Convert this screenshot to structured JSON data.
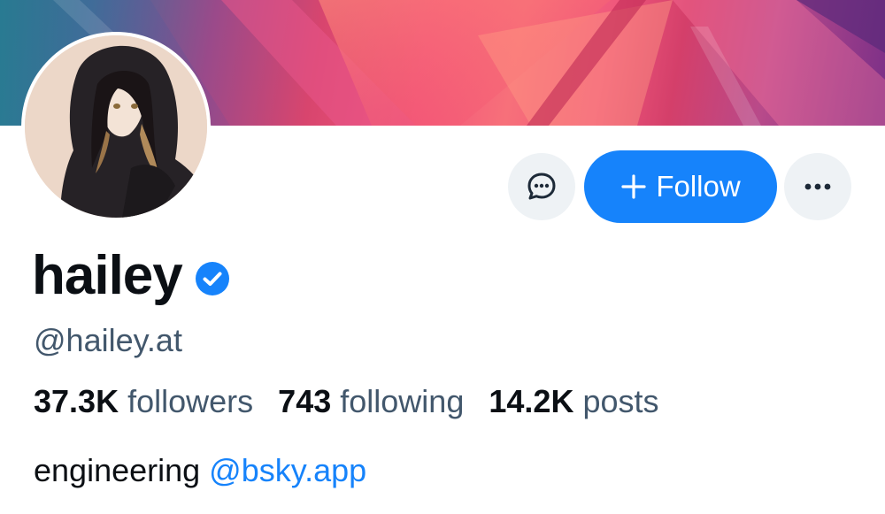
{
  "profile": {
    "display_name": "hailey",
    "handle": "@hailey.at",
    "verified": true
  },
  "actions": {
    "follow_label": "Follow",
    "message_icon": "chat-bubble-icon",
    "more_icon": "ellipsis-icon"
  },
  "stats": {
    "followers_count": "37.3K",
    "followers_label": "followers",
    "following_count": "743",
    "following_label": "following",
    "posts_count": "14.2K",
    "posts_label": "posts"
  },
  "bio": {
    "text": "engineering",
    "link": "@bsky.app"
  },
  "colors": {
    "accent": "#1683fb",
    "text_primary": "#0b0f14",
    "text_secondary": "#42576c",
    "button_bg": "#eef2f5"
  }
}
